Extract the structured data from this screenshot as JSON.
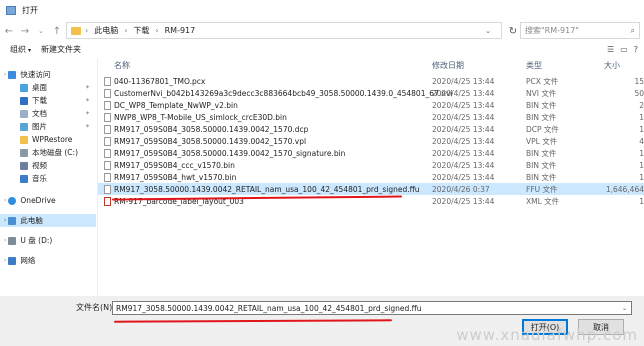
{
  "window": {
    "title": "打开"
  },
  "address": {
    "path": [
      "此电脑",
      "下载",
      "RM-917"
    ],
    "separator": "›",
    "search_placeholder": "搜索\"RM-917\""
  },
  "toolbar": {
    "organize": "组织",
    "new_folder": "新建文件夹"
  },
  "sidebar": [
    {
      "label": "快速访问",
      "icon": "star-icon"
    },
    {
      "label": "桌面",
      "icon": "desktop-icon"
    },
    {
      "label": "下载",
      "icon": "download-icon"
    },
    {
      "label": "文档",
      "icon": "document-icon"
    },
    {
      "label": "图片",
      "icon": "pictures-icon"
    },
    {
      "label": "WPRestore",
      "icon": "folder-icon"
    },
    {
      "label": "本地磁盘 (C:)",
      "icon": "drive-icon"
    },
    {
      "label": "视频",
      "icon": "video-icon"
    },
    {
      "label": "音乐",
      "icon": "music-icon"
    },
    {
      "label": "OneDrive",
      "icon": "cloud-icon"
    },
    {
      "label": "此电脑",
      "icon": "computer-icon"
    },
    {
      "label": "U 盘 (D:)",
      "icon": "usb-icon"
    },
    {
      "label": "网络",
      "icon": "network-icon"
    }
  ],
  "columns": {
    "name": "名称",
    "date": "修改日期",
    "type": "类型",
    "size": "大小"
  },
  "files": [
    {
      "name": "040-11367801_TMO.pcx",
      "date": "2020/4/25 13:44",
      "type": "PCX 文件",
      "size": "15"
    },
    {
      "name": "CustomerNvi_b042b143269a3c9decc3c883664bcb49_3058.50000.1439.0_454801_67.nvi",
      "date": "2020/4/25 13:44",
      "type": "NVI 文件",
      "size": "50"
    },
    {
      "name": "DC_WP8_Template_NwWP_v2.bin",
      "date": "2020/4/25 13:44",
      "type": "BIN 文件",
      "size": "2"
    },
    {
      "name": "NWP8_WP8_T-Mobile_US_simlock_crcE30D.bin",
      "date": "2020/4/25 13:44",
      "type": "BIN 文件",
      "size": "1"
    },
    {
      "name": "RM917_059S0B4_3058.50000.1439.0042_1570.dcp",
      "date": "2020/4/25 13:44",
      "type": "DCP 文件",
      "size": "1"
    },
    {
      "name": "RM917_059S0B4_3058.50000.1439.0042_1570.vpl",
      "date": "2020/4/25 13:44",
      "type": "VPL 文件",
      "size": "4"
    },
    {
      "name": "RM917_059S0B4_3058.50000.1439.0042_1570_signature.bin",
      "date": "2020/4/25 13:44",
      "type": "BIN 文件",
      "size": "1"
    },
    {
      "name": "RM917_059S0B4_ccc_v1570.bin",
      "date": "2020/4/25 13:44",
      "type": "BIN 文件",
      "size": "1"
    },
    {
      "name": "RM917_059S0B4_hwt_v1570.bin",
      "date": "2020/4/25 13:44",
      "type": "BIN 文件",
      "size": "1"
    },
    {
      "name": "RM917_3058.50000.1439.0042_RETAIL_nam_usa_100_42_454801_prd_signed.ffu",
      "date": "2020/4/26 0:37",
      "type": "FFU 文件",
      "size": "1,646,464"
    },
    {
      "name": "RM-917_barcode_label_layout_003",
      "date": "2020/4/25 13:44",
      "type": "XML 文件",
      "size": "1"
    }
  ],
  "filename": {
    "label": "文件名(N):",
    "value": "RM917_3058.50000.1439.0042_RETAIL_nam_usa_100_42_454801_prd_signed.ffu"
  },
  "buttons": {
    "open": "打开(O)",
    "cancel": "取消"
  },
  "watermark": "www.xnadiafwhp.com",
  "colors": {
    "selection": "#cce8ff",
    "underline": "#e0161b",
    "accent": "#0078d7"
  }
}
